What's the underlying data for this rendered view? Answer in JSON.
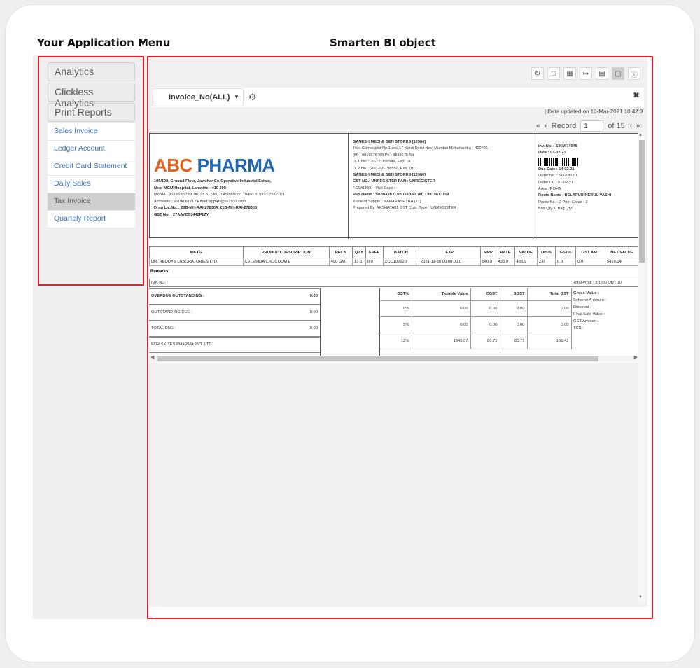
{
  "headings": {
    "left": "Your Application Menu",
    "right": "Smarten BI object"
  },
  "menu": {
    "groups": [
      "Analytics",
      "Clickless Analytics",
      "Print Reports"
    ],
    "items": [
      "Sales Invoice",
      "Ledger Account",
      "Credit Card Statement",
      "Daily Sales",
      "Tax Invoice",
      "Quartely Report"
    ],
    "active_item": "Tax Invoice"
  },
  "toolbar": {
    "icons": [
      "refresh-icon",
      "save-icon",
      "broadcast-icon",
      "export-icon",
      "table-icon",
      "page-icon",
      "info-icon"
    ]
  },
  "params": {
    "invoice_dropdown": "Invoice_No(ALL)"
  },
  "status": {
    "updated": "| Data updated on 10-Mar-2021 10:42:3",
    "record_label": "Record",
    "record_value": "1",
    "record_total": "of 15"
  },
  "invoice": {
    "logo_abc": "ABC",
    "logo_pharma": "PHARMA",
    "company_address": [
      "105/108, Ground Floor, Jawahar Co-Operative Industrial Estate,",
      "Near MGM Hospital, Lamothe - 410 209",
      "Mobile : 96198 61739, 96198 61740, 7045032622, 70450 31593 / 758 / 011",
      "Accounts : 96198 61712 Email: spplkh@sk1932.com",
      "Drug Lic.No. : 20B-MH-RAI-278304, 21B-MH-RAI-278305",
      "GST No. : 27AAYCS3442F1ZY"
    ],
    "customer": [
      "GANESH MEDI & GEN STORES [12984]",
      "Twin Corner,plot No.1,sec-17 Nerul Nerul Navi Mumbai Maharashtra - 400706",
      "(M) : 9819676468 Ph : 9819676468",
      "DL1 No. : 20-TZ-198549, Exp. Dt. :",
      "DL2 No. : 20C-TZ-198550, Exp. Dt. :",
      "GANESH MEDI & GEN STORES [12984]",
      "GST NO.: UNREGISTER PAN : UNREGISTER",
      "FSSAI NO. : Visit Days :",
      "Rep Name : Subhash D.bhusari-ka (M) : 9819413159",
      "Place of Supply : MAHARASHTRA (27)",
      "Prepared By: AKSHATA01 GST Cust. Type : UNREGISTER"
    ],
    "meta_top": [
      "Inv. No. : SIKM/74945",
      "Date : 01-02-21"
    ],
    "meta_bottom": [
      "Due Date : 14-02-21",
      "Order No. : SO208001",
      "Order Dt. : 01-02-21",
      "Area : ROHA",
      "Route Name : BELAPUR-NERUL-VASHI",
      "Route No. : 2 Print-Count : 2",
      "Box Qty: 0 Bag Qty: 1"
    ],
    "line_headers": [
      "MKTG",
      "PRODUCT DESCRIPTION",
      "PACK",
      "QTY",
      "FREE",
      "BATCH",
      "EXP",
      "MRP",
      "RATE",
      "VALUE",
      "DIS%",
      "GST%",
      "GST AMT",
      "NET VALUE"
    ],
    "lines": [
      [
        "DR. REDDYS LABORATORIES LTD.",
        "CELEVIDA CHOCOLATE",
        "400 GM",
        "12.0",
        "0.0",
        "ZCC100620",
        "2021-11-30 00:00:00.0",
        "640.0",
        "433.9",
        "433.9",
        "2.0",
        "0.0",
        "0.0",
        "5419.04"
      ]
    ],
    "remarks": "Remarks:",
    "irn": "IRN NO. :",
    "totals_right": "Total Prod. : 8   Total Qty : 10",
    "outstanding": [
      {
        "label": "OVERDUE OUTSTANDING :",
        "amount": "0.00"
      },
      {
        "label": "OUTSTANDING DUE :",
        "amount": "0.00"
      },
      {
        "label": "TOTAL DUE :",
        "amount": "0.00"
      },
      {
        "label": "FOR SKITES PHARMA PVT. LTD.",
        "amount": ""
      }
    ],
    "gst_headers": [
      "GST%",
      "Taxable Value",
      "CGST",
      "SGST",
      "Total GST"
    ],
    "gst_rows": [
      [
        "0%",
        "0.00",
        "0.00",
        "0.00",
        "0.00"
      ],
      [
        "5%",
        "0.00",
        "0.00",
        "0.00",
        "0.00"
      ],
      [
        "12%",
        "1345.07",
        "80.71",
        "80.71",
        "161.42"
      ]
    ],
    "gross": [
      "Gross Value :",
      "Scheme A mount :",
      "Discount :",
      "Final Sale Value :",
      "GST Amount :",
      "TCS :"
    ]
  }
}
